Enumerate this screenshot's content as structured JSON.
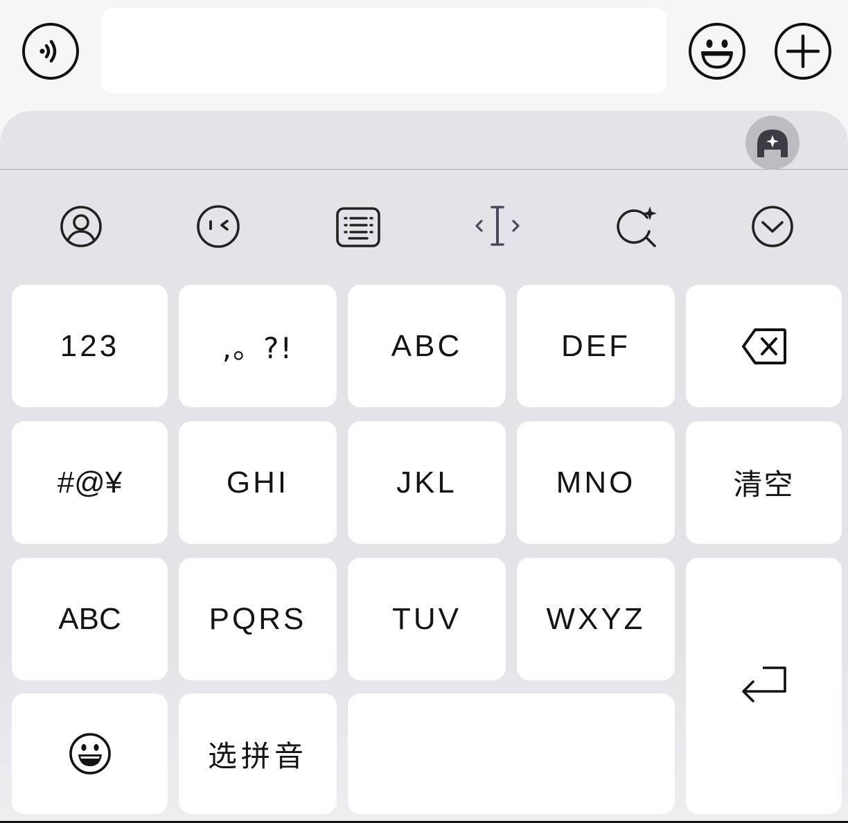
{
  "input_bar": {
    "voice_icon": "voice-wave-icon",
    "text_value": "",
    "emoji_icon": "smiley-icon",
    "plus_icon": "plus-circle-icon"
  },
  "keyboard": {
    "ai_icon": "ai-assistant-icon",
    "toolbar": [
      {
        "name": "account",
        "icon": "user-circle-icon"
      },
      {
        "name": "emoticon",
        "icon": "wink-face-icon"
      },
      {
        "name": "keyboard-switch",
        "icon": "keyboard-icon"
      },
      {
        "name": "cursor-move",
        "icon": "text-cursor-icon"
      },
      {
        "name": "search",
        "icon": "sparkle-search-icon"
      },
      {
        "name": "collapse",
        "icon": "chevron-down-circle-icon"
      }
    ],
    "keys": {
      "num": "123",
      "punct": ",。?!",
      "abc": "ABC",
      "def": "DEF",
      "backspace_icon": "backspace-icon",
      "symbols": "#@¥",
      "ghi": "GHI",
      "jkl": "JKL",
      "mno": "MNO",
      "clear": "清空",
      "abc_switch": "ABC",
      "pqrs": "PQRS",
      "tuv": "TUV",
      "wxyz": "WXYZ",
      "return_icon": "return-arrow-icon",
      "emoji_icon": "grinning-face-icon",
      "pinyin": "选拼音",
      "space": ""
    }
  }
}
